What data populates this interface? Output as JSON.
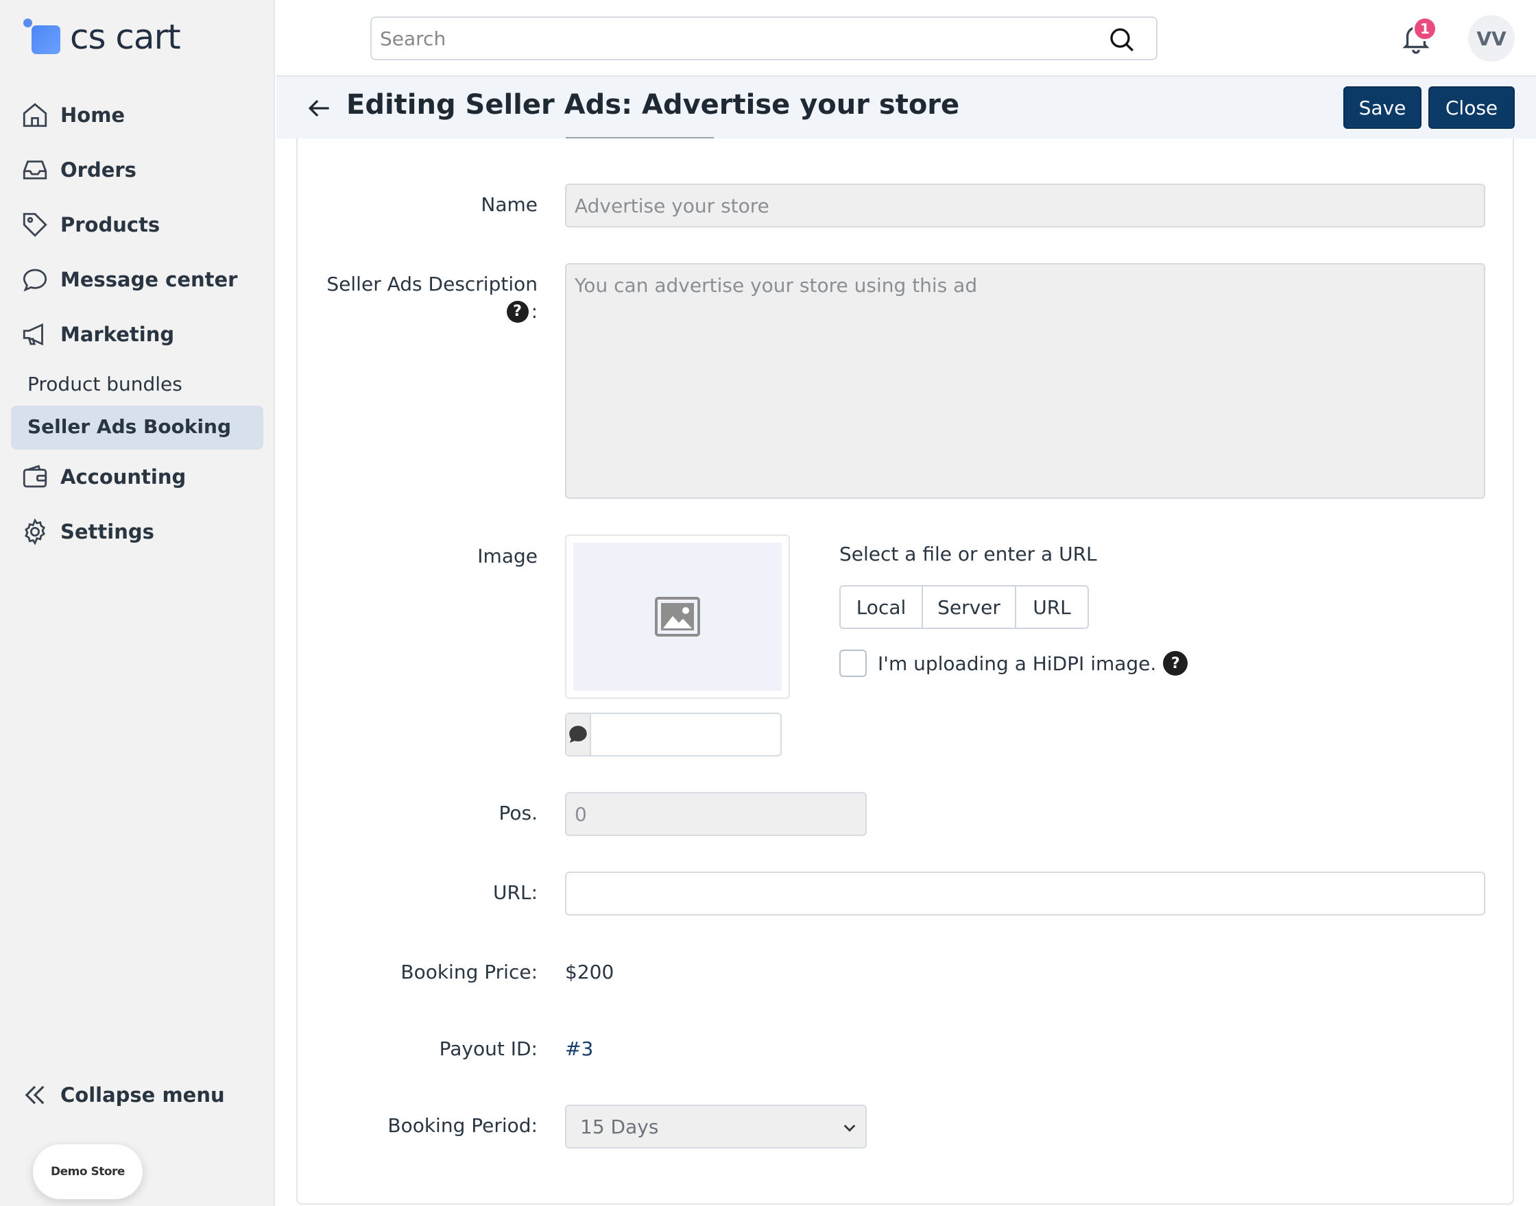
{
  "app": {
    "logo_text": "cs cart",
    "brand_color": "#5b8def",
    "store_badge": "Demo Store"
  },
  "sidebar": {
    "items": [
      {
        "label": "Home",
        "icon": "home-icon"
      },
      {
        "label": "Orders",
        "icon": "inbox-icon"
      },
      {
        "label": "Products",
        "icon": "tag-icon"
      },
      {
        "label": "Message center",
        "icon": "chat-bubble-icon"
      },
      {
        "label": "Marketing",
        "icon": "megaphone-icon"
      },
      {
        "label": "Accounting",
        "icon": "wallet-icon"
      },
      {
        "label": "Settings",
        "icon": "gear-icon"
      }
    ],
    "marketing_sub": [
      {
        "label": "Product bundles"
      },
      {
        "label": "Seller Ads Booking",
        "active": true
      }
    ],
    "collapse_label": "Collapse menu"
  },
  "topbar": {
    "search_placeholder": "Search",
    "notification_count": "1",
    "avatar_initials": "VV"
  },
  "header": {
    "title": "Editing Seller Ads: Advertise your store",
    "save_label": "Save",
    "close_label": "Close",
    "accent_color": "#0b3a66"
  },
  "form": {
    "name": {
      "label": "Name",
      "value": "Advertise your store"
    },
    "description": {
      "label": "Seller Ads Description",
      "label_suffix": ":",
      "value": "You can advertise your store using this ad"
    },
    "image": {
      "label": "Image",
      "hint": "Select a file or enter a URL",
      "sources": [
        "Local",
        "Server",
        "URL"
      ],
      "hidpi_label": "I'm uploading a HiDPI image.",
      "alt_value": ""
    },
    "position": {
      "label": "Pos.",
      "value": "0"
    },
    "url": {
      "label": "URL:",
      "value": ""
    },
    "booking_price": {
      "label": "Booking Price:",
      "value": "$200"
    },
    "payout_id": {
      "label": "Payout ID:",
      "value": "#3"
    },
    "booking_period": {
      "label": "Booking Period:",
      "value": "15 Days"
    }
  },
  "help_glyph": "?"
}
